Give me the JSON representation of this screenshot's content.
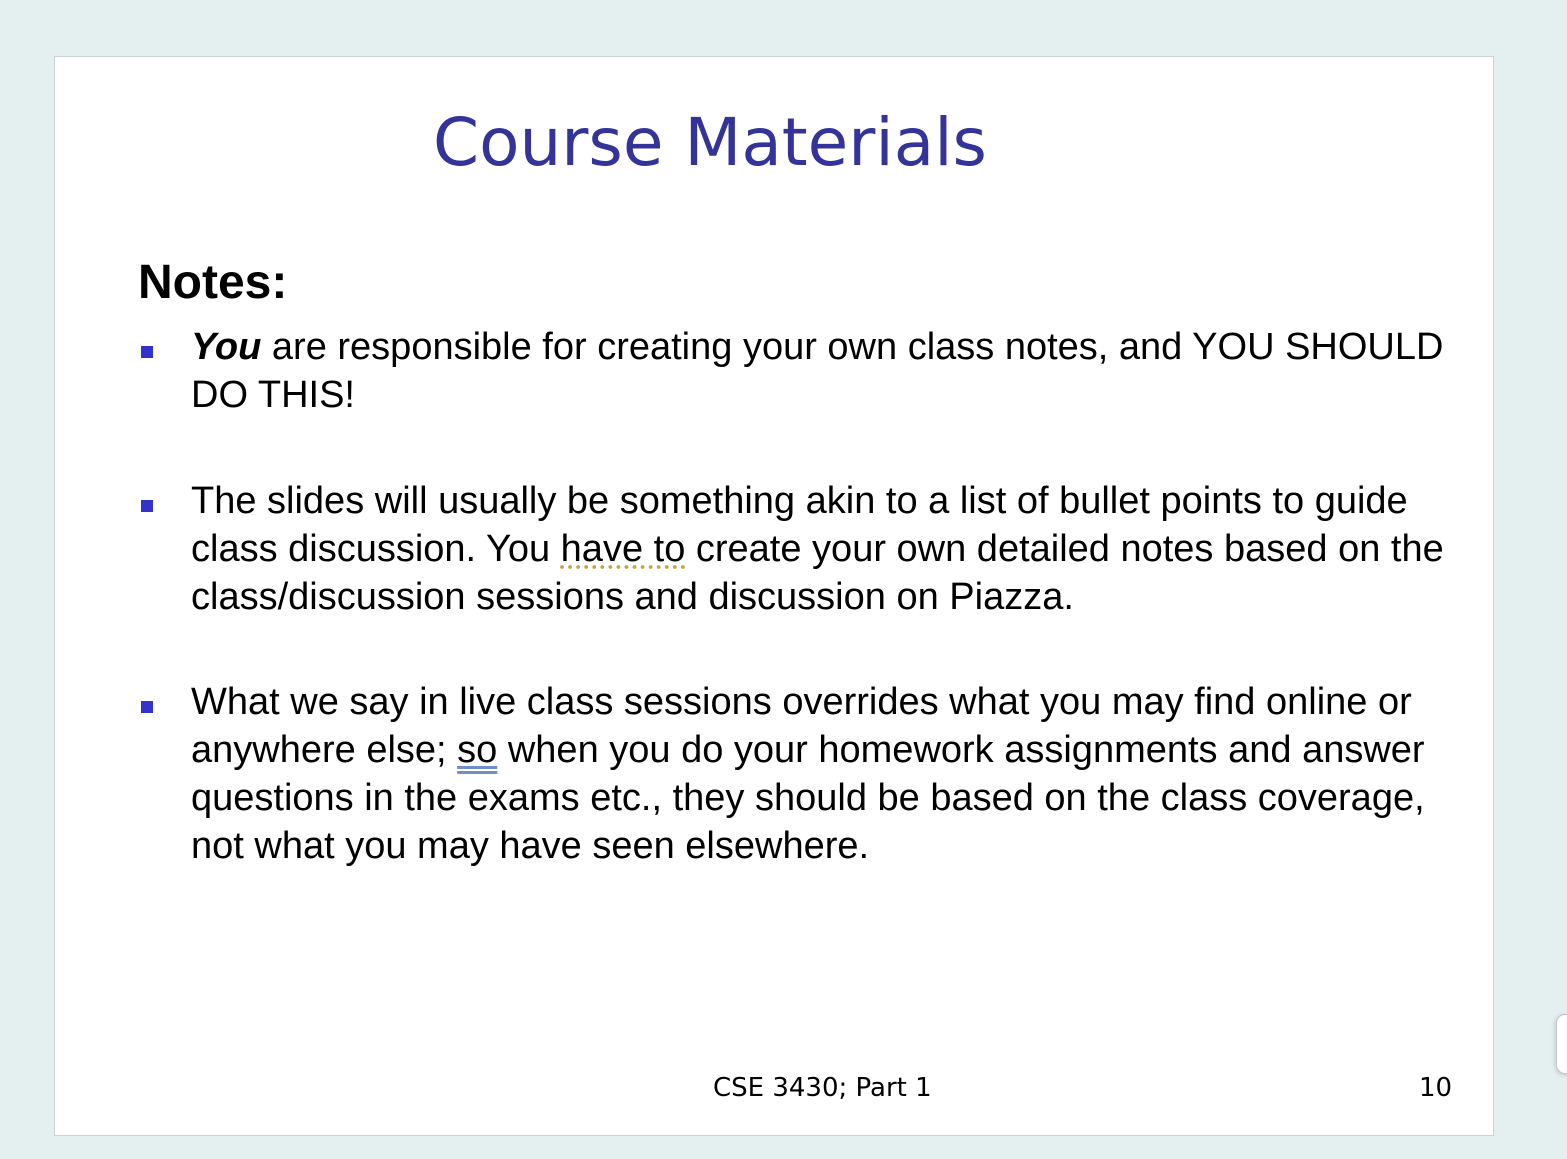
{
  "slide": {
    "title": "Course Materials",
    "heading": "Notes:",
    "bullets": [
      {
        "emphasis": "You",
        "text": " are responsible for creating your own class notes, and YOU SHOULD DO THIS!"
      },
      {
        "before": "The slides will usually be something akin to a list of bullet points to guide class discussion. You ",
        "underlined": "have to",
        "after": " create your own detailed notes based on the class/discussion sessions and discussion on Piazza."
      },
      {
        "before": "What we say in live class sessions overrides what you may find online or anywhere else; ",
        "underlined": "so",
        "after": " when you do your homework assignments and answer questions in the exams etc., they should be based on the class coverage, not what you may have seen elsewhere."
      }
    ],
    "footer": "CSE 3430; Part 1",
    "page_number": "10"
  },
  "colors": {
    "title": "#333399",
    "bullet_marker": "#3333cc",
    "background": "#e4eff0",
    "slide": "#ffffff"
  }
}
